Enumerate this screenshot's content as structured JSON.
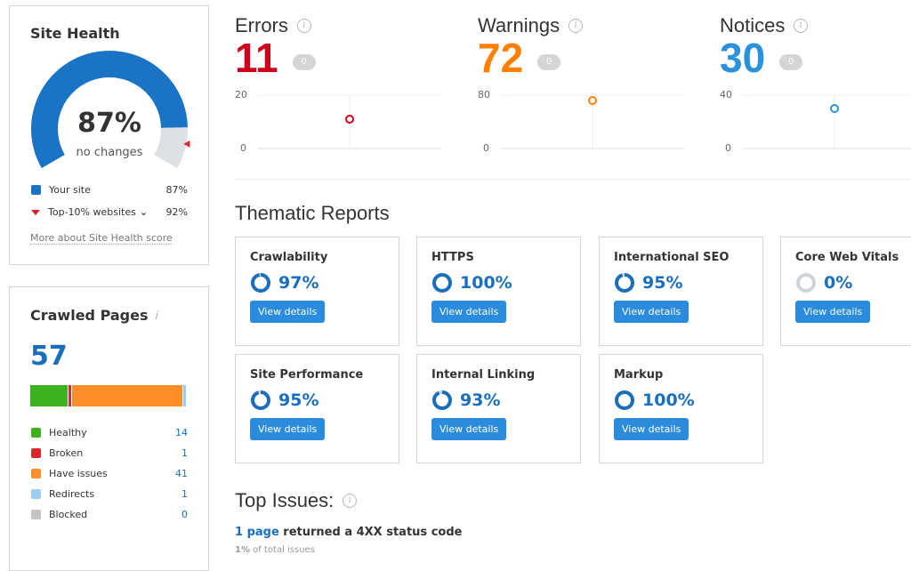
{
  "site_health": {
    "title": "Site Health",
    "percent": 87,
    "percent_label": "87%",
    "change": "no changes",
    "top10": 92,
    "legend": [
      {
        "label": "Your site",
        "value": "87%"
      },
      {
        "label": "Top-10% websites",
        "value": "92%"
      }
    ],
    "link": "More about Site Health score",
    "colors": {
      "site": "#1a73c4",
      "rest": "#dde1e5",
      "marker": "#d9262c"
    }
  },
  "crawled": {
    "title": "Crawled Pages",
    "total": "57",
    "items": [
      {
        "label": "Healthy",
        "value": "14",
        "color": "#3cb21e"
      },
      {
        "label": "Broken",
        "value": "1",
        "color": "#e0242b"
      },
      {
        "label": "Have issues",
        "value": "41",
        "color": "#ff8f2b"
      },
      {
        "label": "Redirects",
        "value": "1",
        "color": "#9ccbf0"
      },
      {
        "label": "Blocked",
        "value": "0",
        "color": "#c4c4c4"
      }
    ]
  },
  "metrics": [
    {
      "title": "Errors",
      "value": "11",
      "delta": "0",
      "color": "#d0021b",
      "ymax": "20",
      "ymin": "0",
      "point": 11
    },
    {
      "title": "Warnings",
      "value": "72",
      "delta": "0",
      "color": "#ff7f00",
      "ymax": "80",
      "ymin": "0",
      "point": 72
    },
    {
      "title": "Notices",
      "value": "30",
      "delta": "0",
      "color": "#2a92dc",
      "ymax": "40",
      "ymin": "0",
      "point": 30
    }
  ],
  "thematic": {
    "title": "Thematic Reports",
    "button": "View details",
    "cards": [
      {
        "name": "Crawlability",
        "pct": "97%",
        "v": 97
      },
      {
        "name": "HTTPS",
        "pct": "100%",
        "v": 100
      },
      {
        "name": "International SEO",
        "pct": "95%",
        "v": 95
      },
      {
        "name": "Core Web Vitals",
        "pct": "0%",
        "v": 0
      },
      {
        "name": "Site Performance",
        "pct": "95%",
        "v": 95
      },
      {
        "name": "Internal Linking",
        "pct": "93%",
        "v": 93
      },
      {
        "name": "Markup",
        "pct": "100%",
        "v": 100
      }
    ]
  },
  "top_issues": {
    "title": "Top Issues:",
    "link": "1 page",
    "text": " returned a 4XX status code",
    "share": "1%",
    "share_text": " of total issues"
  }
}
